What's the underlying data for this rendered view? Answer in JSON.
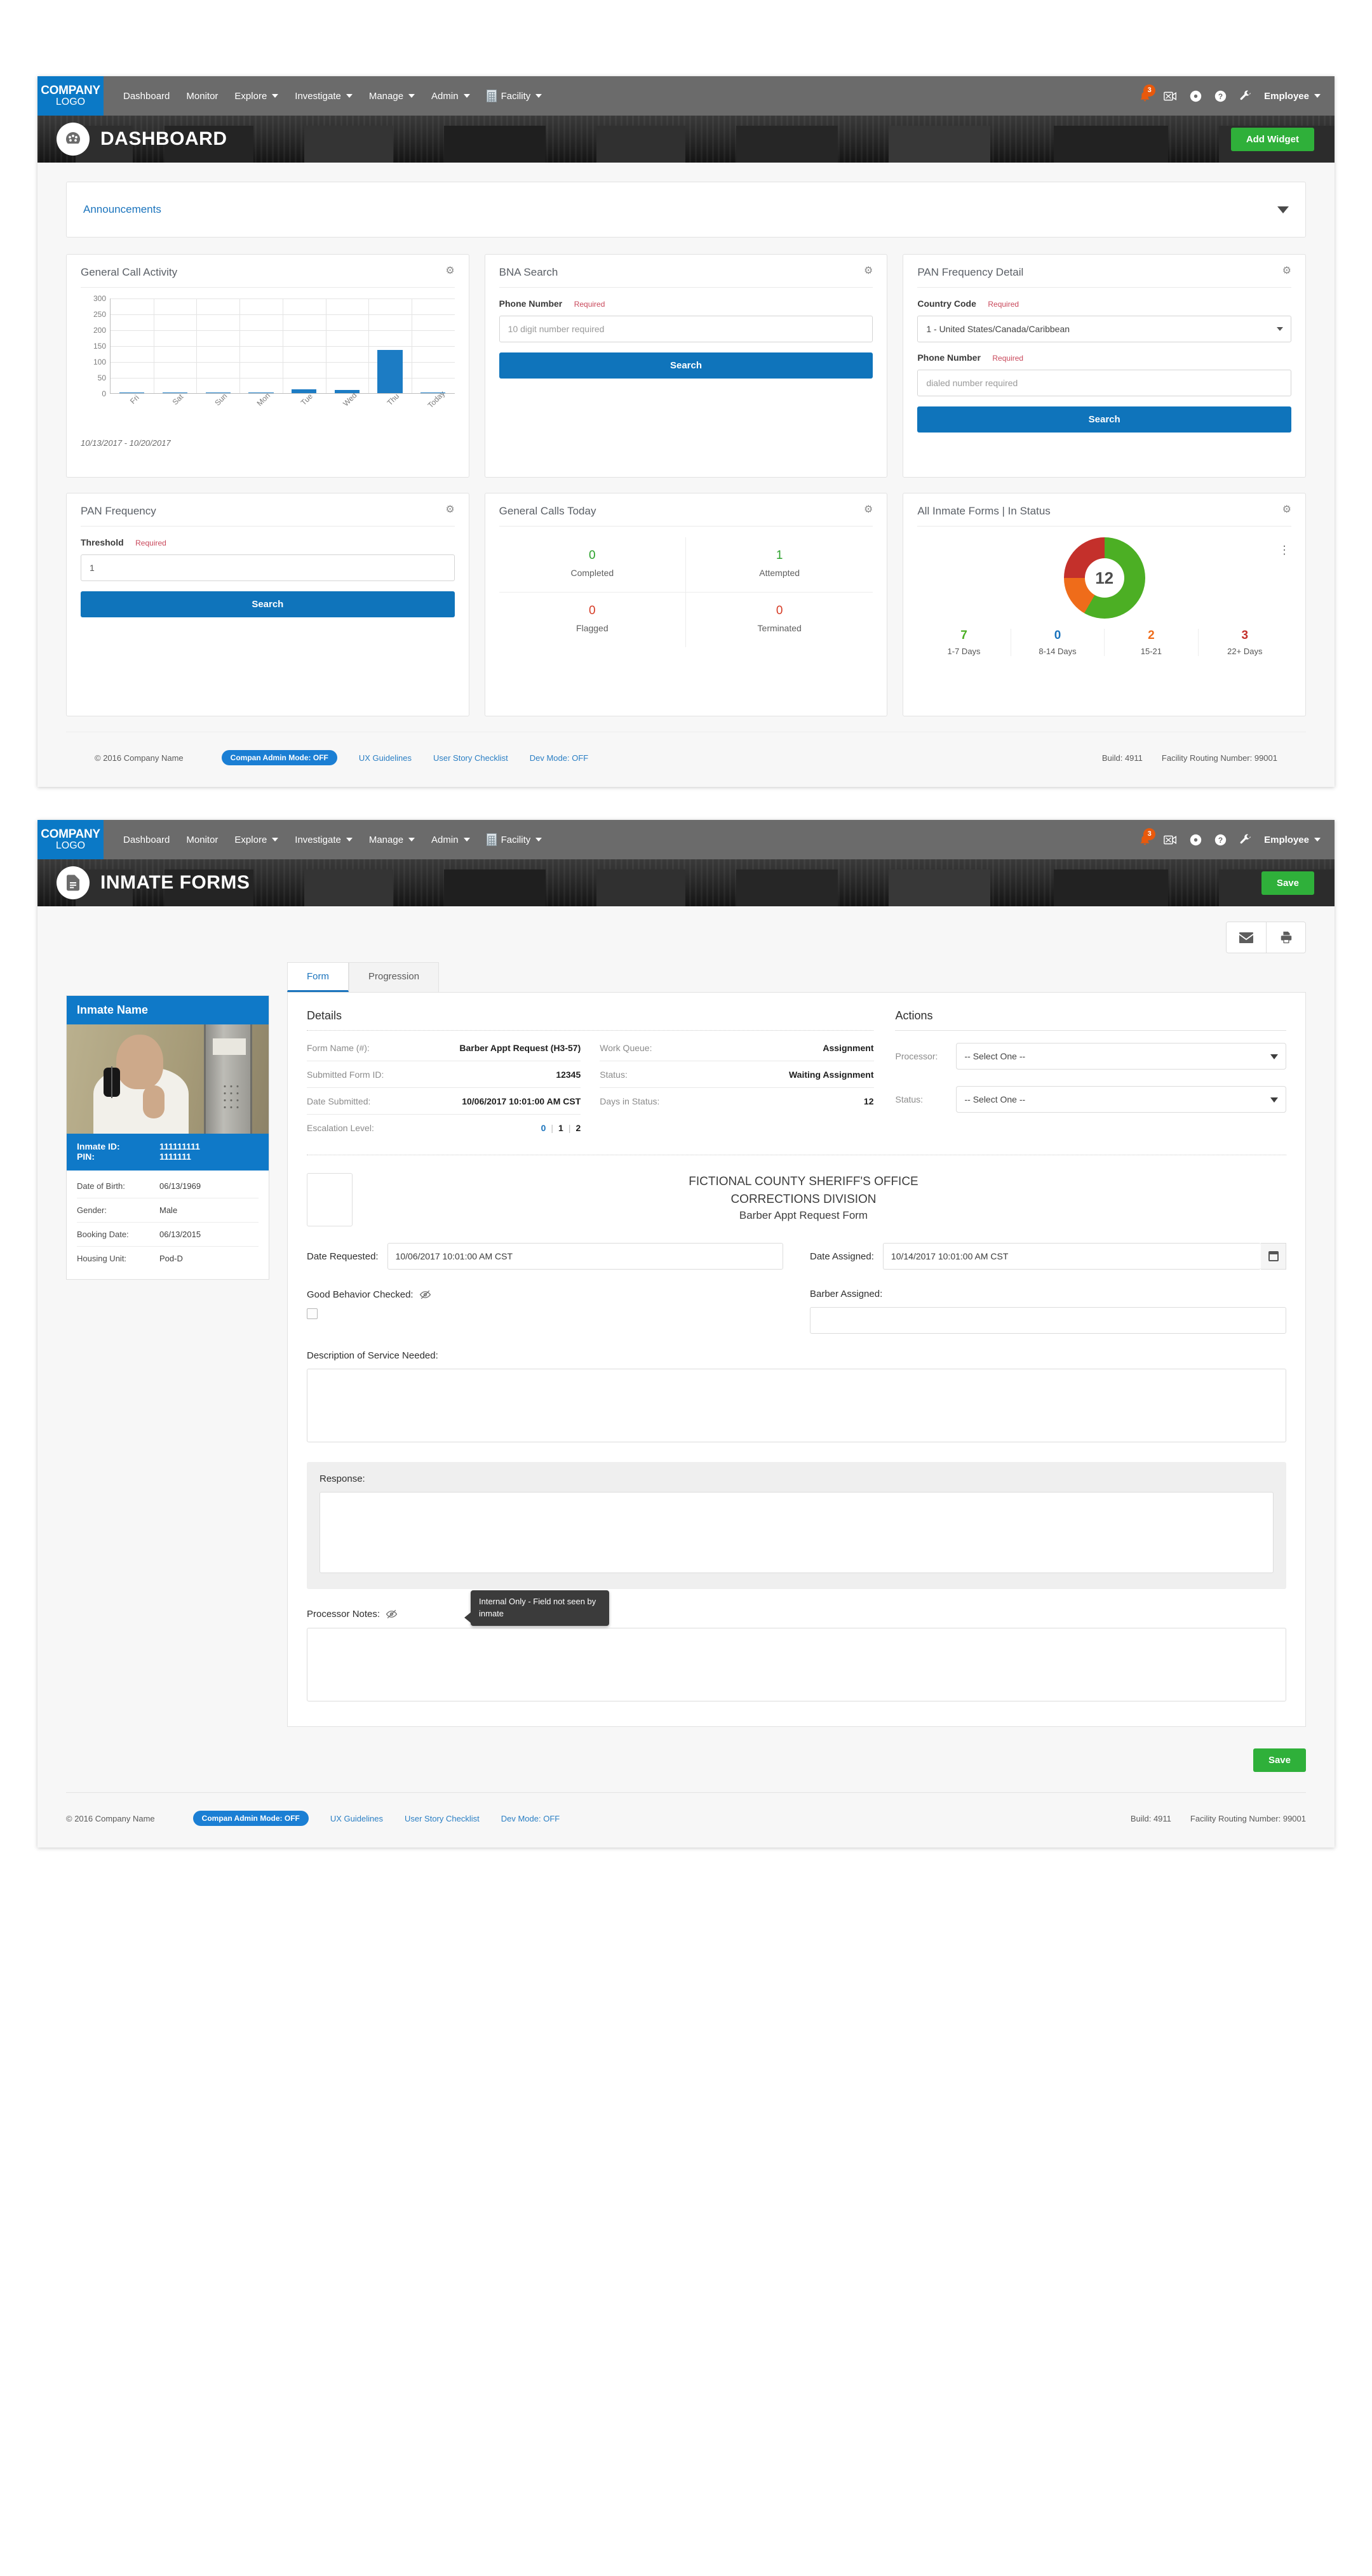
{
  "nav": {
    "brand_line1": "COMPANY",
    "brand_line2": "LOGO",
    "items": [
      {
        "label": "Dashboard",
        "caret": false
      },
      {
        "label": "Monitor",
        "caret": false
      },
      {
        "label": "Explore",
        "caret": true
      },
      {
        "label": "Investigate",
        "caret": true
      },
      {
        "label": "Manage",
        "caret": true
      },
      {
        "label": "Admin",
        "caret": true
      },
      {
        "label": "Facility",
        "caret": true,
        "icon": "facility-icon"
      }
    ],
    "notification_count": "3",
    "icons": [
      "bell-icon",
      "video-off-icon",
      "record-icon",
      "help-icon",
      "wrench-icon"
    ],
    "user_label": "Employee"
  },
  "dashboard": {
    "banner_title": "DASHBOARD",
    "banner_icon": "speedometer-icon",
    "add_widget_label": "Add Widget",
    "announcements_label": "Announcements",
    "widgets": {
      "call_activity": {
        "title": "General Call Activity",
        "range_note": "10/13/2017 - 10/20/2017"
      },
      "bna_search": {
        "title": "BNA Search",
        "phone_label": "Phone Number",
        "required": "Required",
        "phone_placeholder": "10 digit number required",
        "phone_value": "",
        "search_label": "Search"
      },
      "pan_detail": {
        "title": "PAN Frequency Detail",
        "country_label": "Country Code",
        "required": "Required",
        "country_value": "1 - United States/Canada/Caribbean",
        "phone_label": "Phone Number",
        "phone_placeholder": "dialed number required",
        "phone_value": "",
        "search_label": "Search"
      },
      "pan_frequency": {
        "title": "PAN Frequency",
        "threshold_label": "Threshold",
        "required": "Required",
        "threshold_value": "1",
        "search_label": "Search"
      },
      "calls_today": {
        "title": "General Calls Today",
        "stats": [
          {
            "value": "0",
            "label": "Completed",
            "color": "#2aa12a"
          },
          {
            "value": "1",
            "label": "Attempted",
            "color": "#2aa12a"
          },
          {
            "value": "0",
            "label": "Flagged",
            "color": "#d63b25"
          },
          {
            "value": "0",
            "label": "Terminated",
            "color": "#d63b25"
          }
        ]
      },
      "inmate_forms_status": {
        "title": "All Inmate Forms | In Status",
        "center_total": "12"
      }
    },
    "footer": {
      "copyright": "© 2016 Company Name",
      "admin_pill": "Compan Admin Mode: OFF",
      "links": [
        "UX Guidelines",
        "User Story Checklist",
        "Dev Mode: OFF"
      ],
      "build": "Build: 4911",
      "routing": "Facility Routing Number: 99001"
    }
  },
  "chart_data": [
    {
      "type": "bar",
      "title": "General Call Activity",
      "categories": [
        "Fri",
        "Sat",
        "Sun",
        "Mon",
        "Tue",
        "Wed",
        "Thu",
        "Today"
      ],
      "values": [
        1,
        0,
        0,
        1,
        12,
        10,
        137,
        1
      ],
      "yticks": [
        0,
        50,
        100,
        150,
        200,
        250,
        300
      ],
      "ylim": [
        0,
        300
      ],
      "xlabel": "",
      "ylabel": "",
      "grid": true,
      "legend": "none",
      "annotation": "10/13/2017 - 10/20/2017",
      "bar_color": "#1c7cc4"
    },
    {
      "type": "pie",
      "title": "All Inmate Forms | In Status",
      "center_label": "12",
      "categories": [
        "1-7 Days",
        "8-14 Days",
        "15-21",
        "22+ Days"
      ],
      "values": [
        7,
        0,
        2,
        3
      ],
      "colors": [
        "#4caf24",
        "#1b74bd",
        "#ef6c1a",
        "#c4302b"
      ],
      "legend": "bottom"
    }
  ],
  "forms": {
    "banner_title": "INMATE FORMS",
    "banner_icon": "document-icon",
    "save_label": "Save",
    "save_label_bottom": "Save",
    "toolbar_icons": [
      "email-icon",
      "print-icon"
    ],
    "inmate_card": {
      "header": "Inmate Name",
      "photo_alt": "inmate-photo",
      "id_label": "Inmate ID:",
      "id_value": "111111111",
      "pin_label": "PIN:",
      "pin_value": "1111111",
      "rows": [
        {
          "k": "Date of Birth:",
          "v": "06/13/1969"
        },
        {
          "k": "Gender:",
          "v": "Male"
        },
        {
          "k": "Booking Date:",
          "v": "06/13/2015"
        },
        {
          "k": "Housing Unit:",
          "v": "Pod-D"
        }
      ]
    },
    "tabs": [
      {
        "label": "Form",
        "active": true
      },
      {
        "label": "Progression",
        "active": false
      }
    ],
    "details": {
      "title": "Details",
      "left_rows": [
        {
          "k": "Form Name (#):",
          "v": "Barber Appt Request  (H3-57)"
        },
        {
          "k": "Submitted Form ID:",
          "v": "12345"
        },
        {
          "k": "Date Submitted:",
          "v": "10/06/2017 10:01:00 AM CST"
        }
      ],
      "right_rows": [
        {
          "k": "Work Queue:",
          "v": "Assignment"
        },
        {
          "k": "Status:",
          "v": "Waiting Assignment"
        },
        {
          "k": "Days in Status:",
          "v": "12"
        }
      ],
      "escalation_label": "Escalation Level:",
      "escalation_levels": [
        "0",
        "1",
        "2"
      ],
      "escalation_active": "0"
    },
    "actions": {
      "title": "Actions",
      "processor_label": "Processor:",
      "processor_value": "-- Select One --",
      "status_label": "Status:",
      "status_value": "-- Select One --"
    },
    "document": {
      "org_line1": "FICTIONAL COUNTY SHERIFF'S OFFICE",
      "org_line2": "CORRECTIONS DIVISION",
      "form_title": "Barber Appt Request Form",
      "date_requested_label": "Date Requested:",
      "date_requested_value": "10/06/2017 10:01:00 AM CST",
      "date_assigned_label": "Date Assigned:",
      "date_assigned_value": "10/14/2017 10:01:00 AM CST",
      "good_behavior_label": "Good Behavior Checked:",
      "good_behavior_checked": false,
      "barber_assigned_label": "Barber Assigned:",
      "barber_assigned_value": "",
      "description_label": "Description of Service Needed:",
      "description_value": "",
      "response_label": "Response:",
      "response_value": "",
      "processor_notes_label": "Processor Notes:",
      "processor_notes_value": "",
      "tooltip_text": "Internal Only - Field not seen by inmate"
    },
    "footer": {
      "copyright": "© 2016 Company Name",
      "admin_pill": "Compan Admin Mode: OFF",
      "links": [
        "UX Guidelines",
        "User Story Checklist",
        "Dev Mode: OFF"
      ],
      "build": "Build: 4911",
      "routing": "Facility Routing Number: 99001"
    }
  }
}
